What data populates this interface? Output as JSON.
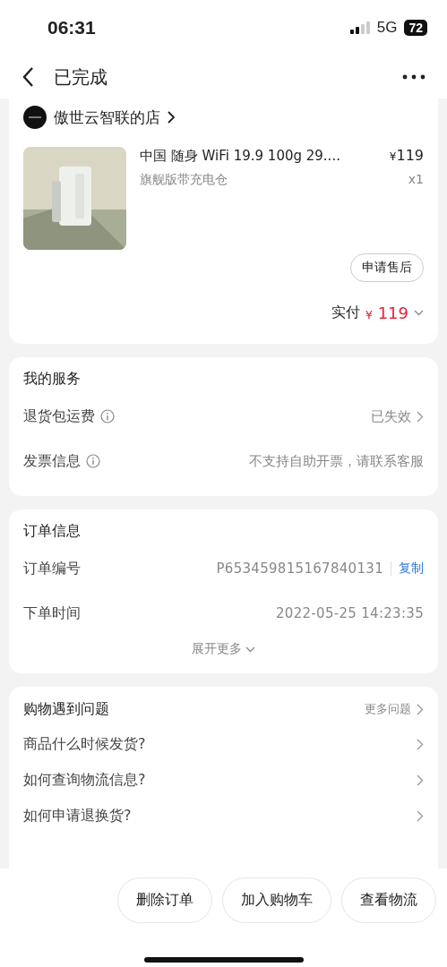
{
  "status_bar": {
    "time": "06:31",
    "network": "5G",
    "battery": "72"
  },
  "nav": {
    "title": "已完成"
  },
  "order_card": {
    "shop": "傲世云智联的店",
    "product": {
      "kind": "picture",
      "title": "中国 随身 WiFi 19.9 100g 29....",
      "variant": "旗舰版带充电仓",
      "currency": "¥",
      "price": "119",
      "quantity": "x1"
    },
    "after_sale_button": "申请售后",
    "paid_label": "实付",
    "paid_currency": "¥",
    "paid_amount": "119"
  },
  "services": {
    "title": "我的服务",
    "rows": [
      {
        "label": "退货包运费",
        "info": true,
        "value": "已失效",
        "chevron": true
      },
      {
        "label": "发票信息",
        "info": true,
        "value": "不支持自助开票，请联系客服",
        "chevron": false
      }
    ]
  },
  "order_info": {
    "title": "订单信息",
    "rows": [
      {
        "label": "订单编号",
        "value": "P653459815167840131",
        "action": "复制"
      },
      {
        "label": "下单时间",
        "value": "2022-05-25 14:23:35"
      }
    ],
    "expand": "展开更多"
  },
  "problems": {
    "title": "购物遇到问题",
    "more": "更多问题",
    "questions": [
      "商品什么时候发货?",
      "如何查询物流信息?",
      "如何申请退换货?"
    ]
  },
  "actions": [
    "删除订单",
    "加入购物车",
    "查看物流"
  ]
}
